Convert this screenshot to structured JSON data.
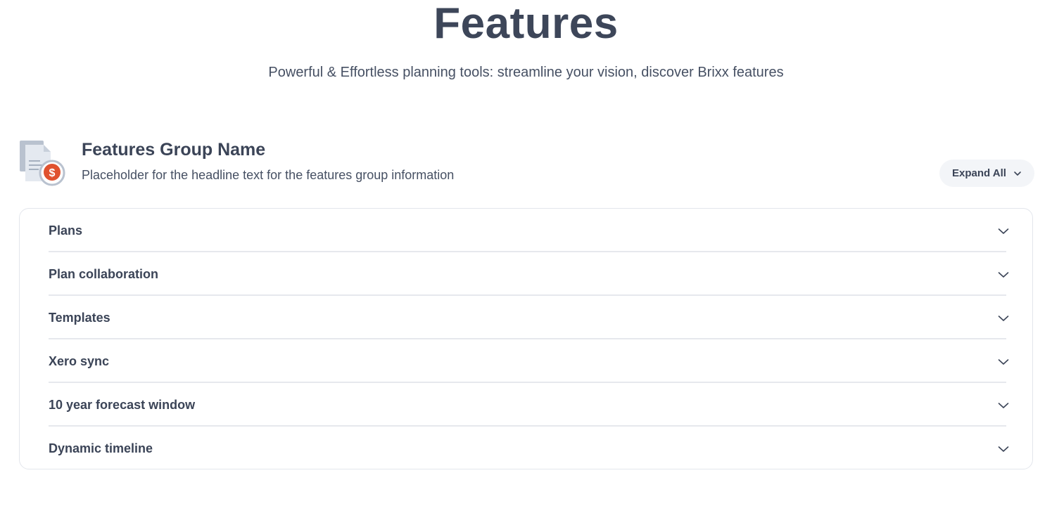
{
  "hero": {
    "title": "Features",
    "subtitle": "Powerful & Effortless planning tools: streamline your vision, discover Brixx features"
  },
  "group": {
    "icon": "document-dollar-icon",
    "title": "Features Group Name",
    "description": "Placeholder for the headline text for the features group information",
    "expand_all_label": "Expand All"
  },
  "accordion": {
    "items": [
      {
        "label": "Plans"
      },
      {
        "label": "Plan collaboration"
      },
      {
        "label": "Templates"
      },
      {
        "label": "Xero sync"
      },
      {
        "label": "10 year forecast window"
      },
      {
        "label": "Dynamic timeline"
      }
    ]
  },
  "colors": {
    "text_primary": "#3b4457",
    "accent_dollar": "#e0522f",
    "border": "#e3e6ec",
    "button_bg": "#f3f5f8"
  }
}
